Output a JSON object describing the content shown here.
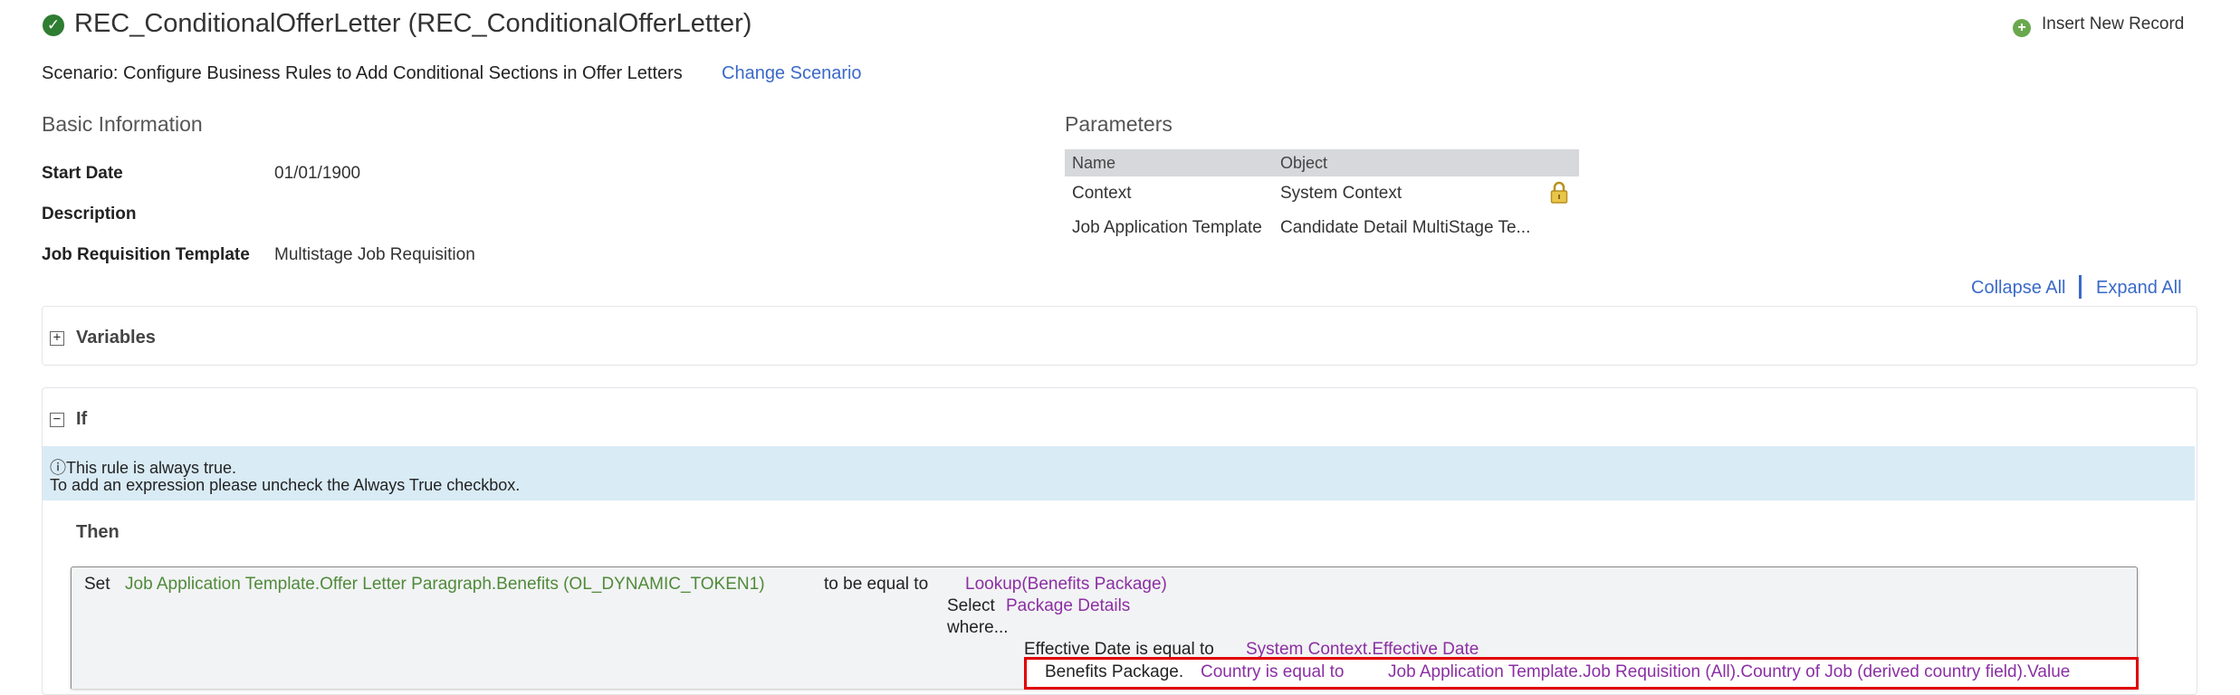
{
  "header": {
    "title": "REC_ConditionalOfferLetter (REC_ConditionalOfferLetter)",
    "status_icon": "check-circle-icon",
    "insert_new_record": "Insert New Record",
    "scenario_text": "Scenario: Configure Business Rules to Add Conditional Sections in Offer Letters",
    "change_scenario": "Change Scenario"
  },
  "basic_info": {
    "title": "Basic Information",
    "fields": [
      {
        "label": "Start Date",
        "value": "01/01/1900"
      },
      {
        "label": "Description",
        "value": ""
      },
      {
        "label": "Job Requisition Template",
        "value": "Multistage Job Requisition"
      }
    ]
  },
  "parameters": {
    "title": "Parameters",
    "columns": [
      "Name",
      "Object"
    ],
    "rows": [
      {
        "name": "Context",
        "object": "System Context",
        "locked": true
      },
      {
        "name": "Job Application Template",
        "object": "Candidate Detail MultiStage Te..."
      }
    ]
  },
  "controls": {
    "collapse_all": "Collapse All",
    "separator": "|",
    "expand_all": "Expand All"
  },
  "variables": {
    "toggle": "+",
    "label": "Variables"
  },
  "if_section": {
    "toggle": "−",
    "label": "If",
    "info_line1": "ⓘThis rule is always true.",
    "info_line2": "To add an expression please uncheck the Always True checkbox."
  },
  "then_section": {
    "label": "Then",
    "set_keyword": "Set",
    "target_field": "Job Application Template.Offer Letter Paragraph.Benefits (OL_DYNAMIC_TOKEN1)",
    "equal_to": "to be equal to",
    "lookup": "Lookup(Benefits Package)",
    "select_keyword": "Select",
    "select_value": "Package Details",
    "where_keyword": "where...",
    "condition1_label": "Effective Date is equal to",
    "condition1_value": "System Context.Effective Date",
    "condition2_label": "Benefits Package.",
    "condition2_field": "Country is equal to",
    "condition2_value": "Job Application Template.Job Requisition (All).Country of Job (derived country field).Value"
  },
  "colors": {
    "link": "#3a69c8",
    "green_token": "#4f8a3a",
    "purple_token": "#8b2fa3",
    "info_banner": "#d9ebf5",
    "highlight": "#e00000"
  }
}
